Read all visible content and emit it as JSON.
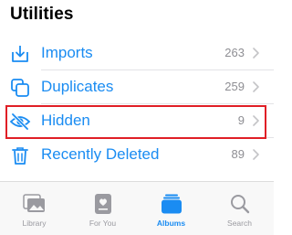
{
  "section": {
    "title": "Utilities"
  },
  "rows": [
    {
      "label": "Imports",
      "count": "263",
      "icon": "import-tray-icon"
    },
    {
      "label": "Duplicates",
      "count": "259",
      "icon": "duplicates-icon"
    },
    {
      "label": "Hidden",
      "count": "9",
      "icon": "eye-slash-icon"
    },
    {
      "label": "Recently Deleted",
      "count": "89",
      "icon": "trash-icon"
    }
  ],
  "tabs": [
    {
      "label": "Library",
      "icon": "library-photos-icon",
      "active": false
    },
    {
      "label": "For You",
      "icon": "for-you-icon",
      "active": false
    },
    {
      "label": "Albums",
      "icon": "albums-icon",
      "active": true
    },
    {
      "label": "Search",
      "icon": "search-icon",
      "active": false
    }
  ],
  "colors": {
    "accent": "#1a8cf2",
    "highlight_border": "#e01f26",
    "secondary_text": "#8e8e93"
  }
}
